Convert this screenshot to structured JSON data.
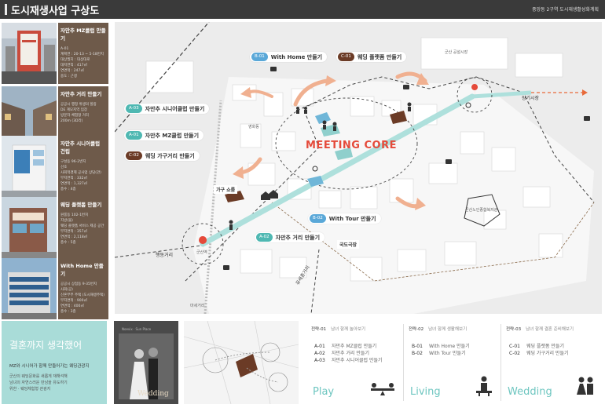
{
  "header": {
    "title": "도시재생사업 구상도",
    "right_text": "중앙동 2구역 도시재생활성화계획"
  },
  "left_cards": [
    {
      "title": "자만추 MZ클럽 만들기",
      "lines": [
        "A-01",
        "계획면 : 20-13 ~ 5-18번지",
        "대상필지 : 대상대로",
        "대지면적 : 417㎡",
        "연면적 : 247㎡",
        "용도 : 근생",
        "층수 : 4층"
      ]
    },
    {
      "title": "자만추 거리 만들기",
      "lines": [
        "공공시 행정 위생의 힐링",
        "DE 계모지역 입장",
        "방문자 체험형 거리",
        "200m (3D라)"
      ]
    },
    {
      "title": "자만추 시니어클럽 건립",
      "lines": [
        "구성동 96-2번지",
        "선호",
        "사회적경제 공사업 상담(관)",
        "부지면적 : 332㎡",
        "연면적 : 1,327㎡",
        "층수 : 4층"
      ]
    },
    {
      "title": "웨딩 플랫폼 만들기",
      "lines": [
        "원룸동 102-1번지",
        "지방(물)",
        "웨딩 플랫폼 서비스 제공 공간",
        "부지면적 : 357㎡",
        "연면적 : 2,118㎡",
        "층수 : 5층"
      ]
    },
    {
      "title": "With Home 만들기",
      "lines": [
        "공공시 상점동 9-35번지",
        "사회(공)",
        "신혼부부 주택 (도시재생주택)",
        "부지면적 : 900㎡",
        "연면적 : 400㎡",
        "층수 : 3층"
      ]
    }
  ],
  "map": {
    "labels": {
      "b01": {
        "code": "B-01",
        "text": "With Home 만들기"
      },
      "c01": {
        "code": "C-01",
        "text": "웨딩 플랫폼 만들기"
      },
      "a03": {
        "code": "A-03",
        "text": "자만추 시니어클럽 만들기"
      },
      "a01": {
        "code": "A-01",
        "text": "자만추 MZ클럽 만들기"
      },
      "c02": {
        "code": "C-02",
        "text": "웨딩 가구거리 만들기"
      },
      "b02": {
        "code": "B-02",
        "text": "With Tour 만들기"
      },
      "a02": {
        "code": "A-02",
        "text": "자만추 거리 만들기"
      }
    },
    "meeting_core": "MEETING    CORE",
    "market_top": "군산 공설시장",
    "market_right": "군산노인종합복지관",
    "station": "군산역",
    "lbl_yeongsan": "영화동",
    "lbl_gagu": "가구 쇼룸",
    "lbl_gukdo": "국도극장",
    "lbl_jeongsanro": "행동거리",
    "lbl_yuwolro": "유세훈거리",
    "lbl_jangsi": "장기시장",
    "lbl_street": "마세거리",
    "colors": {
      "teal": "#4fb8b2",
      "blue": "#5aa8d8",
      "brown": "#6b3b26",
      "accent": "#e54a3a",
      "arrow": "#e8a07a"
    }
  },
  "bottom": {
    "teal_big": "결혼까지 생각했어",
    "teal_sub": "MZ와 시니어가 함께 만들어가는 웨딩관광지",
    "teal_desc": [
      "군산의 웨딩문화를 새롭게 재해석해",
      "남녀의 자연스러운 만남을 유도하기",
      "위한 · 웨딩체험형 관광지"
    ],
    "photo_top": "Noevix · Sun Place",
    "photo_wed": "Wedding"
  },
  "programs": [
    {
      "step": "전략-01",
      "name": "남녀 함께 놀아보기",
      "rows": [
        [
          "A-01",
          "자만추 MZ클럽 만들기"
        ],
        [
          "A-02",
          "자만추 거리 만들기"
        ],
        [
          "A-03",
          "자만추 시니어클럽 만들기"
        ]
      ],
      "word": "Play"
    },
    {
      "step": "전략-02",
      "name": "남녀 함께 생활해보기",
      "rows": [
        [
          "B-01",
          "With Home 만들기"
        ],
        [
          "B-02",
          "With Tour 만들기"
        ]
      ],
      "word": "Living"
    },
    {
      "step": "전략-03",
      "name": "남녀 함께 결혼 준비해보기",
      "rows": [
        [
          "C-01",
          "웨딩 플랫폼 만들기"
        ],
        [
          "C-02",
          "웨딩 가구거리 만들기"
        ]
      ],
      "word": "Wedding"
    }
  ]
}
